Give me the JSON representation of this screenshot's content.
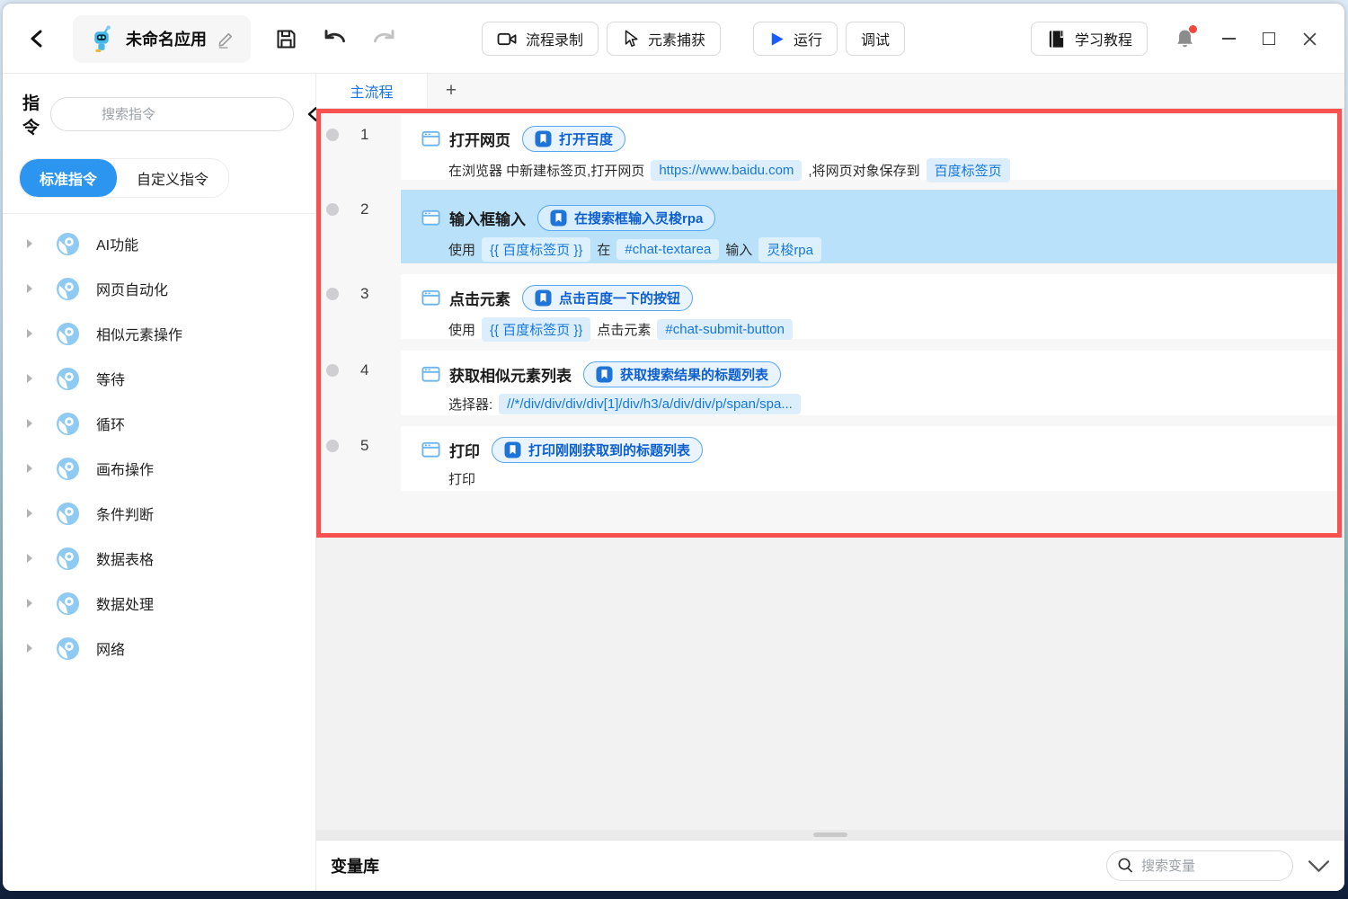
{
  "titlebar": {
    "app_name": "未命名应用",
    "record_label": "流程录制",
    "capture_label": "元素捕获",
    "run_label": "运行",
    "debug_label": "调试",
    "tutorial_label": "学习教程"
  },
  "sidebar": {
    "panel_title": "指令",
    "search_placeholder": "搜索指令",
    "tab_standard": "标准指令",
    "tab_custom": "自定义指令",
    "items": [
      "AI功能",
      "网页自动化",
      "相似元素操作",
      "等待",
      "循环",
      "画布操作",
      "条件判断",
      "数据表格",
      "数据处理",
      "网络"
    ]
  },
  "main": {
    "flow_tab": "主流程",
    "add_tab": "+",
    "steps": [
      {
        "num": "1",
        "title": "打开网页",
        "badge": "打开百度",
        "desc": [
          "在浏览器 中新建标签页,打开网页",
          "https://www.baidu.com",
          ",将网页对象保存到",
          "百度标签页"
        ]
      },
      {
        "num": "2",
        "title": "输入框输入",
        "badge": "在搜索框输入灵梭rpa",
        "desc": [
          "使用",
          "{{ 百度标签页 }}",
          "在",
          "#chat-textarea",
          "输入",
          "灵梭rpa"
        ]
      },
      {
        "num": "3",
        "title": "点击元素",
        "badge": "点击百度一下的按钮",
        "desc": [
          "使用",
          "{{ 百度标签页 }}",
          "点击元素",
          "#chat-submit-button"
        ]
      },
      {
        "num": "4",
        "title": "获取相似元素列表",
        "badge": "获取搜索结果的标题列表",
        "desc": [
          "选择器:",
          "//*/div/div/div/div[1]/div/h3/a/div/div/p/span/spa..."
        ]
      },
      {
        "num": "5",
        "title": "打印",
        "badge": "打印刚刚获取到的标题列表",
        "desc": [
          "打印"
        ]
      }
    ],
    "variables": {
      "title": "变量库",
      "search_placeholder": "搜索变量"
    }
  },
  "colors": {
    "accent_blue": "#2b95f0",
    "badge_text_blue": "#0d5fd0",
    "chip_bg": "#dceefc",
    "row_highlight": "#b9e2fa",
    "highlight_border_red": "#f8514f",
    "notify_red": "#f5473d"
  }
}
